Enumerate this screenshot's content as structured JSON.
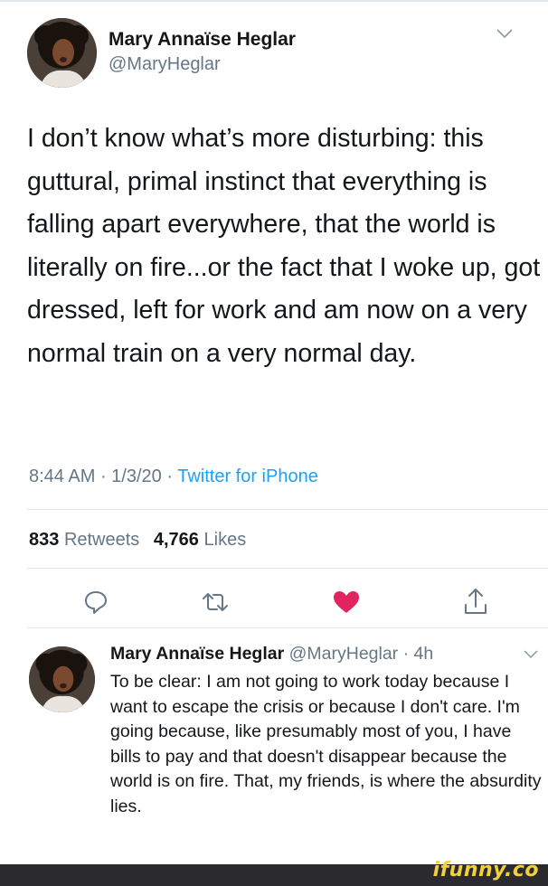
{
  "main_tweet": {
    "author_name": "Mary Annaïse Heglar",
    "author_handle": "@MaryHeglar",
    "text": "I don’t know what’s more disturbing: this guttural, primal instinct that everything is falling apart everywhere, that the world is literally on fire...or the fact that I woke up, got dressed, left for work and am now on a very normal train on a very normal day.",
    "time": "8:44 AM",
    "date": "1/3/20",
    "source": "Twitter for iPhone",
    "separator": " · ",
    "retweet_count": "833",
    "retweet_label": "Retweets",
    "like_count": "4,766",
    "like_label": "Likes",
    "icons": [
      "reply-icon",
      "retweet-icon",
      "like-icon",
      "share-icon"
    ],
    "liked": true,
    "like_color": "#e0245e"
  },
  "reply_tweet": {
    "author_name": "Mary Annaïse Heglar",
    "author_handle": "@MaryHeglar",
    "time_ago": "· 4h",
    "text": "To be clear: I am not going to work today because I want to escape the crisis or because I don't care. I'm going because, like presumably most of you, I have bills to pay and that doesn't disappear because the world is on fire. That, my friends, is where the absurdity lies."
  },
  "watermark": "ifunny.co",
  "colors": {
    "text": "#14171a",
    "secondary": "#657786",
    "link": "#1da1f2",
    "divider": "#e1e8ed"
  }
}
